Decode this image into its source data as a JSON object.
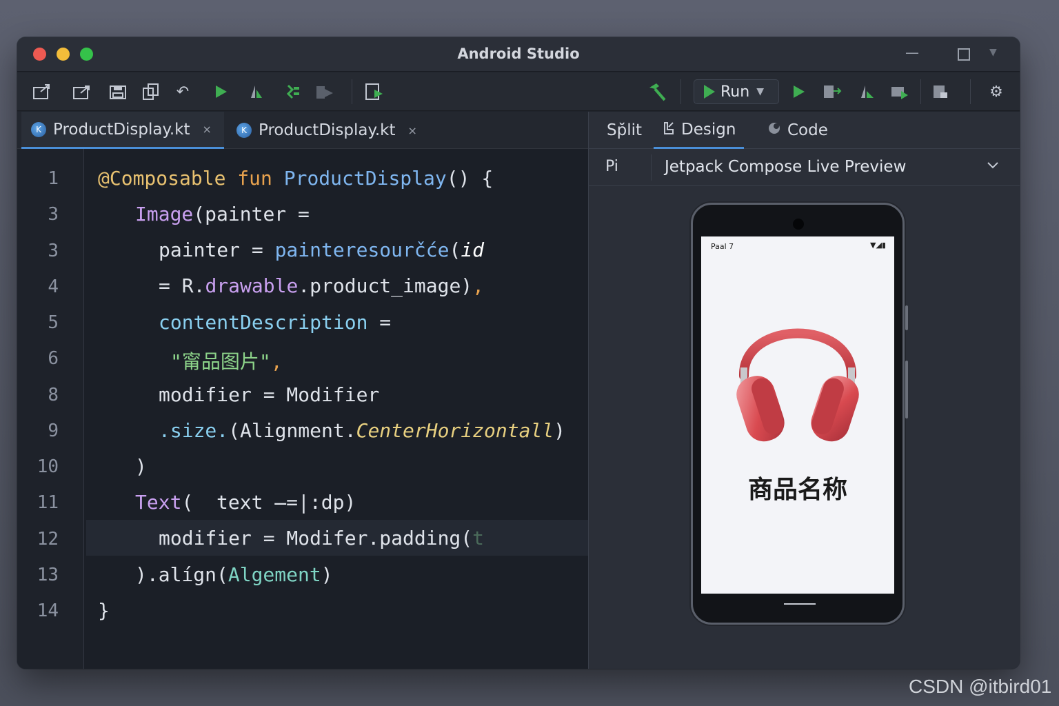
{
  "window": {
    "title": "Android Studio"
  },
  "toolbar": {
    "run_label": "Run",
    "icons": [
      "open-external-icon",
      "share-icon",
      "save-all-icon",
      "copy-icon",
      "undo-icon",
      "run-icon",
      "debug-icon",
      "profile-icon",
      "apply-changes-icon",
      "device-manager-icon",
      "build-hammer-icon",
      "run-green-icon",
      "attach-icon",
      "apply-code-icon",
      "stop-icon",
      "sync-icon",
      "settings-icon"
    ]
  },
  "editor": {
    "tabs": [
      {
        "label": "ProductDisplay.kt",
        "close": "×"
      },
      {
        "label": "ProductDisplay.kt",
        "close": "×"
      }
    ],
    "line_numbers": [
      "1",
      "3",
      "3",
      "4",
      "5",
      "6",
      "8",
      "9",
      "10",
      "11",
      "12",
      "13",
      "14"
    ],
    "lines": {
      "l1": {
        "ann": "@Composable",
        "kw": "fun",
        "fn": "ProductDisplay",
        "rest": "() {"
      },
      "l2": {
        "fn": "Image",
        "rest": "(painter ="
      },
      "l3": {
        "a": "painter = ",
        "fn": "painteresourčće",
        "p": "(",
        "it": "id"
      },
      "l4": {
        "a": "= R.",
        "purp": "drawable",
        "b": ".product_image)",
        "c": ","
      },
      "l5": {
        "cyan": "contentDescription",
        "rest": " ="
      },
      "l6": {
        "str": "\"甯品图片\"",
        "c": ","
      },
      "l7": {
        "a": "modifier = Modifier"
      },
      "l8": {
        "cyan": ".size.",
        "a": "(Alignment.",
        "yel": "CenterHorizontall",
        "b": ")"
      },
      "l9": {
        "a": ")"
      },
      "l10": {
        "purp": "Text",
        "a": "(  text ̶=|:dp)"
      },
      "l11": {
        "a": "modifier = Modifer.padding(",
        "dim": "t"
      },
      "l12": {
        "a": ").alígn(",
        "teal": "Algement",
        "b": ")"
      },
      "l13": {
        "a": "}"
      }
    }
  },
  "preview": {
    "tabs": {
      "split": "Sp̆lit",
      "design": "Design",
      "code": "Code"
    },
    "pi_label": "Pi",
    "selector": "Jetpack Compose Live Preview",
    "phone": {
      "status_time": "Paal 7",
      "status_icons": "▼◢▮",
      "product_name": "商品名称"
    }
  },
  "watermark": "CSDN @itbird01",
  "colors": {
    "accent": "#4a8fd8",
    "run_green": "#3fae52",
    "headphone_red": "#d94a50"
  }
}
